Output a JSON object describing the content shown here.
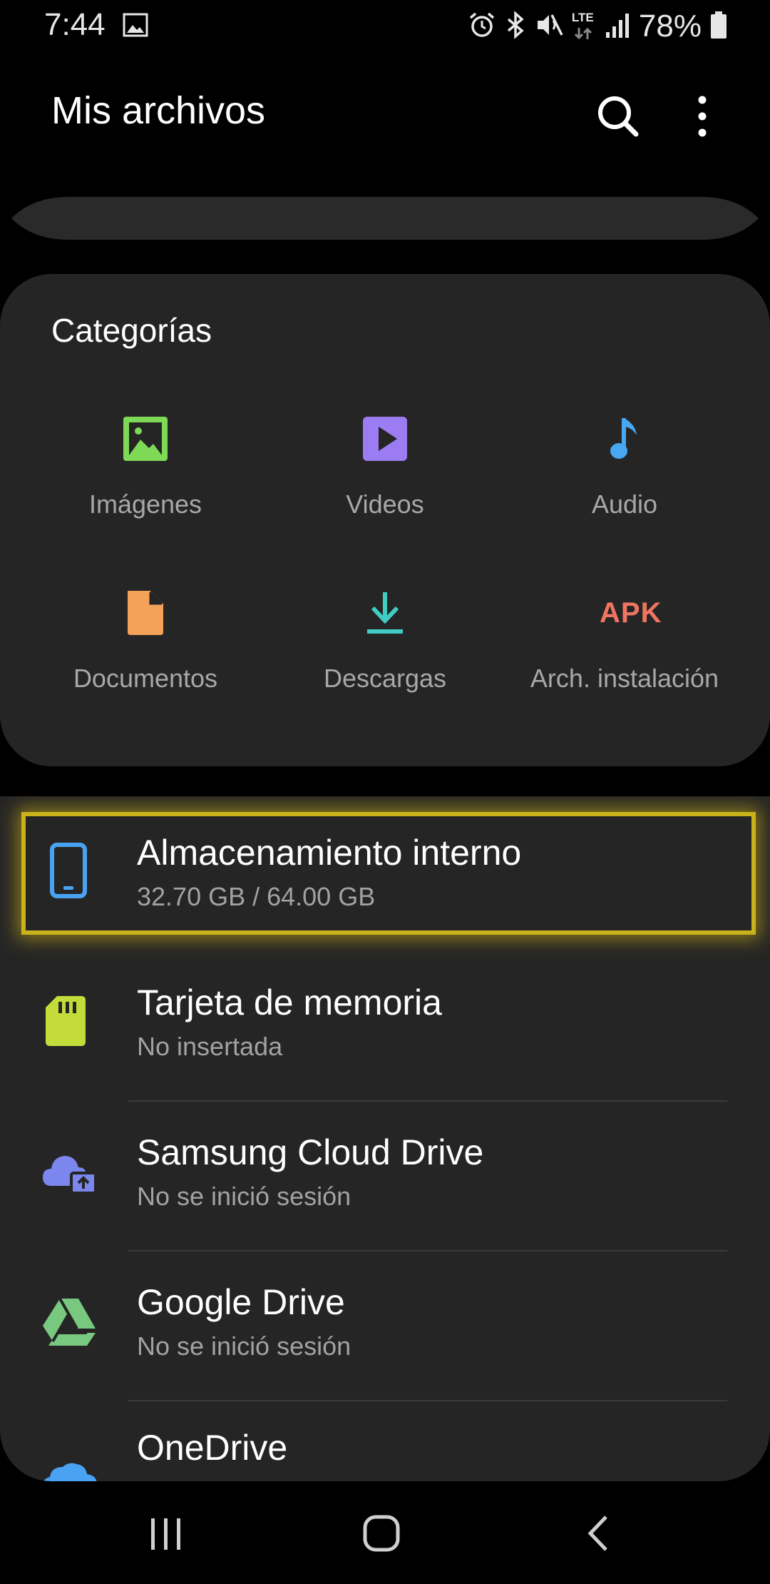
{
  "status_bar": {
    "time": "7:44",
    "network": "LTE",
    "battery_percent": "78%",
    "icons": [
      "image-icon",
      "alarm-icon",
      "bluetooth-icon",
      "mute-icon",
      "lte-icon",
      "signal-icon",
      "battery-icon"
    ]
  },
  "app_bar": {
    "title": "Mis archivos",
    "icons": [
      "search-icon",
      "more-options-icon"
    ]
  },
  "categories": {
    "title": "Categorías",
    "items": [
      {
        "label": "Imágenes",
        "icon": "images-icon",
        "color": "#7ed957"
      },
      {
        "label": "Videos",
        "icon": "video-icon",
        "color": "#9b7cf2"
      },
      {
        "label": "Audio",
        "icon": "audio-icon",
        "color": "#47a7f1"
      },
      {
        "label": "Documentos",
        "icon": "document-icon",
        "color": "#f4a25a"
      },
      {
        "label": "Descargas",
        "icon": "download-icon",
        "color": "#3fcdc3"
      },
      {
        "label": "Arch. instalación",
        "icon": "apk-icon",
        "icon_text": "APK",
        "color": "#ef7561"
      }
    ]
  },
  "storage": [
    {
      "title": "Almacenamiento interno",
      "subtitle": "32.70 GB / 64.00 GB",
      "icon": "phone-icon",
      "color": "#4aa3f2",
      "highlighted": true
    },
    {
      "title": "Tarjeta de memoria",
      "subtitle": "No insertada",
      "icon": "sd-card-icon",
      "color": "#c4dc3a"
    },
    {
      "title": "Samsung Cloud Drive",
      "subtitle": "No se inició sesión",
      "icon": "cloud-upload-icon",
      "color": "#7c87ee"
    },
    {
      "title": "Google Drive",
      "subtitle": "No se inició sesión",
      "icon": "google-drive-icon",
      "color": "#78c97f"
    },
    {
      "title": "OneDrive",
      "subtitle": "",
      "icon": "onedrive-icon",
      "color": "#4aa3f2"
    }
  ],
  "nav_bar": {
    "icons": [
      "recents-icon",
      "home-icon",
      "back-icon"
    ]
  }
}
